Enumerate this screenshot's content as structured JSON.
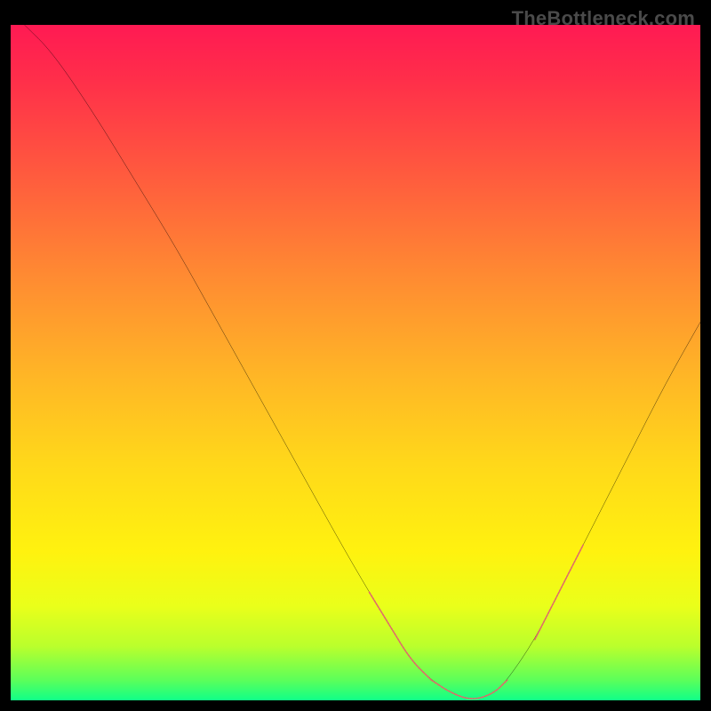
{
  "watermark": "TheBottleneck.com",
  "chart_data": {
    "type": "line",
    "title": "",
    "xlabel": "",
    "ylabel": "",
    "xlim": [
      0,
      100
    ],
    "ylim": [
      0,
      100
    ],
    "grid": false,
    "series": [
      {
        "name": "curve",
        "color": "#000000",
        "x": [
          2,
          6,
          12,
          18,
          24,
          30,
          36,
          42,
          48,
          52,
          55,
          58,
          61,
          64,
          67,
          70,
          72,
          76,
          80,
          85,
          90,
          95,
          100
        ],
        "y": [
          100,
          96,
          87,
          77,
          67,
          56,
          45,
          34,
          23,
          16,
          11,
          6,
          3,
          1,
          0,
          1,
          3,
          9,
          17,
          27,
          37,
          47,
          56
        ]
      },
      {
        "name": "left-dash-band",
        "style": "dashed",
        "color": "#e06a6a",
        "x": [
          52,
          55,
          58,
          61
        ],
        "y": [
          16,
          11,
          6,
          3
        ]
      },
      {
        "name": "bottom-dash-band",
        "style": "dashed",
        "color": "#e06a6a",
        "x": [
          61,
          64,
          67,
          70,
          72
        ],
        "y": [
          3,
          1,
          0,
          1,
          3
        ]
      },
      {
        "name": "right-dash-band",
        "style": "dashed",
        "color": "#e06a6a",
        "x": [
          76,
          80,
          83
        ],
        "y": [
          9,
          17,
          23
        ]
      }
    ],
    "annotations": []
  }
}
